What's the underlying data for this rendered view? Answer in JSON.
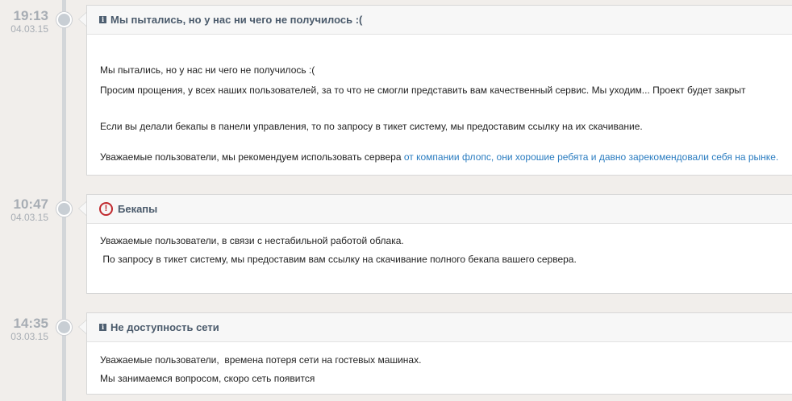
{
  "entries": [
    {
      "time": "19:13",
      "date": "04.03.15",
      "icon": "info-icon",
      "title": "Мы пытались, но у нас ни чего не получилось :(",
      "body": {
        "line1": "Мы пытались, но у нас ни чего не получилось :(",
        "line2": "Просим прощения, у всех наших пользователей, за то что не смогли представить вам качественный сервис. Мы уходим... Проект будет закрыт",
        "line3": "Если вы делали бекапы в панели управления, то по запросу в тикет систему, мы предоставим ссылку на их скачивание.",
        "line4_prefix": "Уважаемые пользователи, мы рекомендуем использовать сервера ",
        "line4_link": "от компании флопс, они хорошие ребята и давно зарекомендовали себя на рынке."
      }
    },
    {
      "time": "10:47",
      "date": "04.03.15",
      "icon": "warning-icon",
      "title": "Бекапы",
      "body": {
        "line1": "Уважаемые пользователи, в связи с нестабильной работой облака.",
        "line2": " По запросу в тикет систему, мы предоставим вам ссылку на скачивание полного бекапа вашего сервера."
      }
    },
    {
      "time": "14:35",
      "date": "03.03.15",
      "icon": "info-icon",
      "title": "Не доступность сети",
      "body": {
        "line1": "Уважаемые пользователи,  времена потеря сети на гостевых машинах.",
        "line2": "Мы занимаемся вопросом, скоро сеть появится"
      }
    }
  ],
  "colors": {
    "background": "#f1eeeb",
    "timeline": "#d3d6d9",
    "title": "#4a5a6b",
    "link": "#2a7cc0",
    "warning": "#c0282d"
  }
}
